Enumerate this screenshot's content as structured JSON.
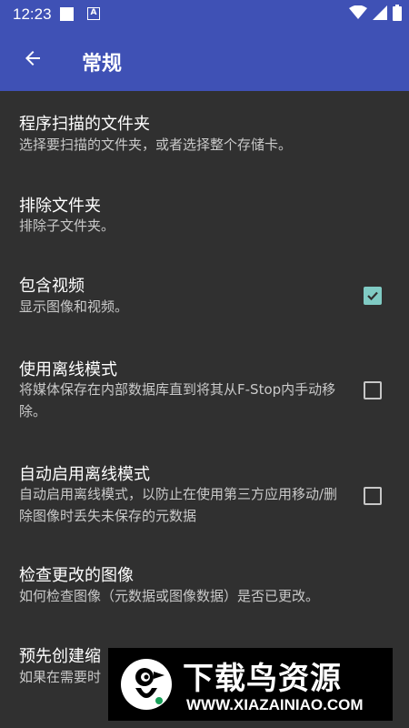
{
  "status_bar": {
    "time": "12:23",
    "icons": [
      "notification-square-icon",
      "a-badge-icon",
      "wifi-icon",
      "signal-icon",
      "battery-icon"
    ]
  },
  "app_bar": {
    "title": "常规",
    "color": "#3F51B5"
  },
  "settings": [
    {
      "title": "程序扫描的文件夹",
      "subtitle": "选择要扫描的文件夹，或者选择整个存储卡。"
    },
    {
      "title": "排除文件夹",
      "subtitle": "排除子文件夹。"
    },
    {
      "title": "包含视频",
      "subtitle": "显示图像和视频。",
      "checked": true
    },
    {
      "title": "使用离线模式",
      "subtitle": "将媒体保存在内部数据库直到将其从F-Stop内手动移除。",
      "checked": false
    },
    {
      "title": "自动启用离线模式",
      "subtitle": "自动启用离线模式，以防止在使用第三方应用移动/删除图像时丢失未保存的元数据",
      "checked": false
    },
    {
      "title": "检查更改的图像",
      "subtitle": "如何检查图像（元数据或图像数据）是否已更改。"
    },
    {
      "title": "预先创建缩",
      "subtitle": "如果在需要时"
    }
  ],
  "watermark": {
    "name": "下载鸟资源",
    "url": "WWW.XIAZAINIAO.COM"
  },
  "accent_color": "#80CBC4"
}
